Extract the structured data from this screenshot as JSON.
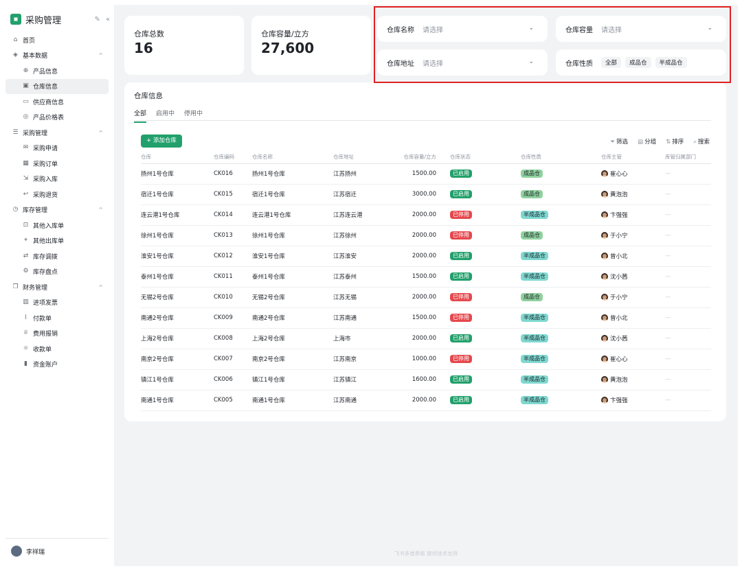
{
  "app": {
    "title": "采购管理",
    "edit_icon": "edit-icon",
    "collapse_icon": "double-chevron-left-icon"
  },
  "nav": [
    {
      "label": "首页",
      "icon": "home-icon",
      "level": 0
    },
    {
      "label": "基本数据",
      "icon": "layers-icon",
      "level": 0,
      "expanded": true
    },
    {
      "label": "产品信息",
      "icon": "globe-icon",
      "level": 1
    },
    {
      "label": "仓库信息",
      "icon": "warehouse-icon",
      "level": 1,
      "active": true
    },
    {
      "label": "供应商信息",
      "icon": "monitor-icon",
      "level": 1
    },
    {
      "label": "产品价格表",
      "icon": "price-icon",
      "level": 1
    },
    {
      "label": "采购管理",
      "icon": "list-icon",
      "level": 0,
      "expanded": true
    },
    {
      "label": "采购申请",
      "icon": "mail-icon",
      "level": 1
    },
    {
      "label": "采购订单",
      "icon": "calendar-icon",
      "level": 1
    },
    {
      "label": "采购入库",
      "icon": "inbound-icon",
      "level": 1
    },
    {
      "label": "采购退货",
      "icon": "return-icon",
      "level": 1
    },
    {
      "label": "库存管理",
      "icon": "clock-icon",
      "level": 0,
      "expanded": true
    },
    {
      "label": "其他入库单",
      "icon": "inbox-icon",
      "level": 1
    },
    {
      "label": "其他出库单",
      "icon": "location-icon",
      "level": 1
    },
    {
      "label": "库存调拨",
      "icon": "transfer-icon",
      "level": 1
    },
    {
      "label": "库存盘点",
      "icon": "gear-icon",
      "level": 1
    },
    {
      "label": "财务管理",
      "icon": "copy-icon",
      "level": 0,
      "expanded": true
    },
    {
      "label": "进项发票",
      "icon": "barcode-icon",
      "level": 1
    },
    {
      "label": "付款单",
      "icon": "chart-icon",
      "level": 1
    },
    {
      "label": "费用报销",
      "icon": "trophy-icon",
      "level": 1
    },
    {
      "label": "收款单",
      "icon": "bulb-icon",
      "level": 1
    },
    {
      "label": "资金账户",
      "icon": "bar-chart-icon",
      "level": 1
    }
  ],
  "user": {
    "name": "李祥瑞"
  },
  "stats": [
    {
      "label": "仓库总数",
      "value": "16"
    },
    {
      "label": "仓库容量/立方",
      "value": "27,600"
    }
  ],
  "filters": {
    "name": {
      "label": "仓库名称",
      "placeholder": "请选择"
    },
    "capacity": {
      "label": "仓库容量",
      "placeholder": "请选择"
    },
    "address": {
      "label": "仓库地址",
      "placeholder": "请选择"
    },
    "nature": {
      "label": "仓库性质",
      "options": [
        "全部",
        "成品仓",
        "半成品仓"
      ]
    }
  },
  "section": {
    "title": "仓库信息",
    "tabs": [
      "全部",
      "启用中",
      "停用中"
    ]
  },
  "toolbar": {
    "add": "+ 添加仓库",
    "filter": "筛选",
    "group": "分组",
    "sort": "排序",
    "search": "搜索"
  },
  "table": {
    "headers": [
      "仓库",
      "仓库编码",
      "仓库名称",
      "仓库地址",
      "仓库容量/立方",
      "仓库状态",
      "仓库性质",
      "仓库主管",
      "库管归属部门"
    ],
    "rows": [
      [
        "扬州1号仓库",
        "CK016",
        "扬州1号仓库",
        "江苏扬州",
        "1500.00",
        "已启用",
        "成品仓",
        "崔心心",
        "—"
      ],
      [
        "宿迁1号仓库",
        "CK015",
        "宿迁1号仓库",
        "江苏宿迁",
        "3000.00",
        "已启用",
        "成品仓",
        "黄泡泡",
        "—"
      ],
      [
        "连云港1号仓库",
        "CK014",
        "连云港1号仓库",
        "江苏连云港",
        "2000.00",
        "已停用",
        "半成品仓",
        "卞强强",
        "—"
      ],
      [
        "徐州1号仓库",
        "CK013",
        "徐州1号仓库",
        "江苏徐州",
        "2000.00",
        "已停用",
        "成品仓",
        "于小宁",
        "—"
      ],
      [
        "淮安1号仓库",
        "CK012",
        "淮安1号仓库",
        "江苏淮安",
        "2000.00",
        "已启用",
        "半成品仓",
        "曾小北",
        "—"
      ],
      [
        "泰州1号仓库",
        "CK011",
        "泰州1号仓库",
        "江苏泰州",
        "1500.00",
        "已启用",
        "半成品仓",
        "沈小茜",
        "—"
      ],
      [
        "无锡2号仓库",
        "CK010",
        "无锡2号仓库",
        "江苏无锡",
        "2000.00",
        "已停用",
        "成品仓",
        "于小宁",
        "—"
      ],
      [
        "南通2号仓库",
        "CK009",
        "南通2号仓库",
        "江苏南通",
        "1500.00",
        "已停用",
        "半成品仓",
        "曾小北",
        "—"
      ],
      [
        "上海2号仓库",
        "CK008",
        "上海2号仓库",
        "上海市",
        "2000.00",
        "已启用",
        "半成品仓",
        "沈小茜",
        "—"
      ],
      [
        "南京2号仓库",
        "CK007",
        "南京2号仓库",
        "江苏南京",
        "1000.00",
        "已停用",
        "半成品仓",
        "崔心心",
        "—"
      ],
      [
        "镇江1号仓库",
        "CK006",
        "镇江1号仓库",
        "江苏镇江",
        "1600.00",
        "已启用",
        "半成品仓",
        "黄泡泡",
        "—"
      ],
      [
        "南通1号仓库",
        "CK005",
        "南通1号仓库",
        "江苏南通",
        "2000.00",
        "已启用",
        "半成品仓",
        "卞强强",
        "—"
      ]
    ]
  },
  "footer": "飞书多维表格 提供技术支持",
  "colors": {
    "accent": "#22a06b",
    "danger": "#e5484d",
    "highlight": "#e02020"
  }
}
